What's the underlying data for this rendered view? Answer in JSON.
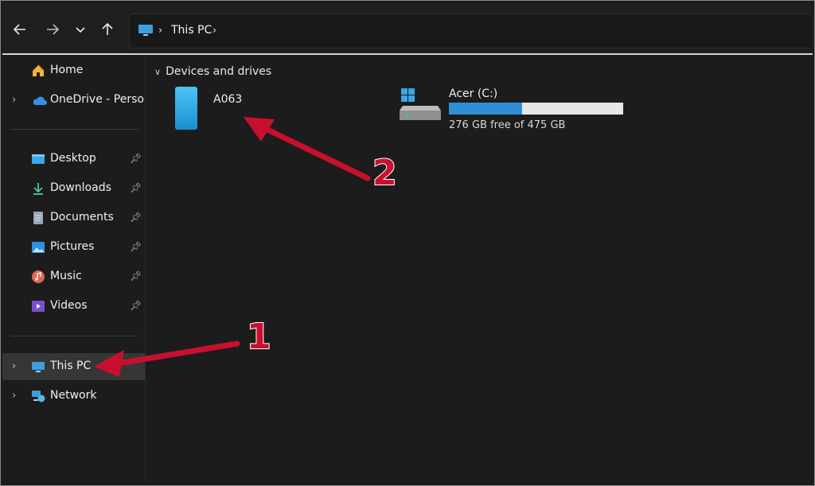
{
  "address_bar": {
    "crumb": "This PC"
  },
  "sidebar": {
    "home": "Home",
    "onedrive": "OneDrive - Persona",
    "pinned": [
      {
        "label": "Desktop",
        "icon": "desktop-icon"
      },
      {
        "label": "Downloads",
        "icon": "downloads-icon"
      },
      {
        "label": "Documents",
        "icon": "documents-icon"
      },
      {
        "label": "Pictures",
        "icon": "pictures-icon"
      },
      {
        "label": "Music",
        "icon": "music-icon"
      },
      {
        "label": "Videos",
        "icon": "videos-icon"
      }
    ],
    "this_pc": "This PC",
    "network": "Network"
  },
  "content": {
    "group_title": "Devices and drives",
    "device": {
      "name": "A063"
    },
    "drive": {
      "name": "Acer (C:)",
      "free_text": "276 GB free of 475 GB",
      "used_fraction": 0.42
    }
  },
  "annotations": {
    "callout_1": "1",
    "callout_2": "2"
  },
  "colors": {
    "accent": "#2f8fd6",
    "callout": "#c8102e",
    "background": "#1c1c1c"
  }
}
